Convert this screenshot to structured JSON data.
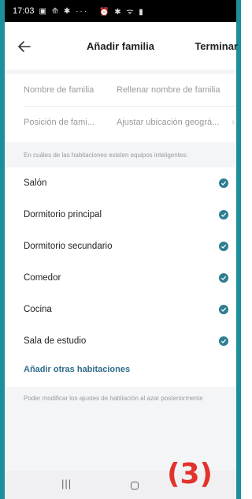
{
  "status_bar": {
    "time": "17:03",
    "left_icons": "▣ ⟰ ✱ ···",
    "right_icons": "⏰ ✱ ᯤ ▮"
  },
  "header": {
    "title": "Añadir familia",
    "done_label": "Terminar",
    "back_icon": "arrow-left-icon"
  },
  "fields": [
    {
      "label": "Nombre de familia",
      "value": "Rellenar nombre de familia",
      "chevron": ""
    },
    {
      "label": "Posición de fami...",
      "value": "Ajustar ubicación geográ...",
      "chevron": "›"
    }
  ],
  "rooms_section": {
    "heading": "En cuáles de las habitaciones existen equipos inteligentes:",
    "rooms": [
      {
        "label": "Salón",
        "checked": true
      },
      {
        "label": "Dormitorio principal",
        "checked": true
      },
      {
        "label": "Dormitorio secundario",
        "checked": true
      },
      {
        "label": "Comedor",
        "checked": true
      },
      {
        "label": "Cocina",
        "checked": true
      },
      {
        "label": "Sala de estudio",
        "checked": true
      }
    ],
    "add_rooms_label": "Añadir otras habitaciones",
    "footnote": "Poder modificar los ajustes de habitación al azar posteriormente"
  },
  "nav_bar": {
    "recent_glyph": "|||"
  },
  "overlay_badge": "(3)",
  "colors": {
    "accent": "#2f7d90",
    "link": "#2f6d8a",
    "frame": "#1b8f9a",
    "badge": "#e3322b"
  }
}
